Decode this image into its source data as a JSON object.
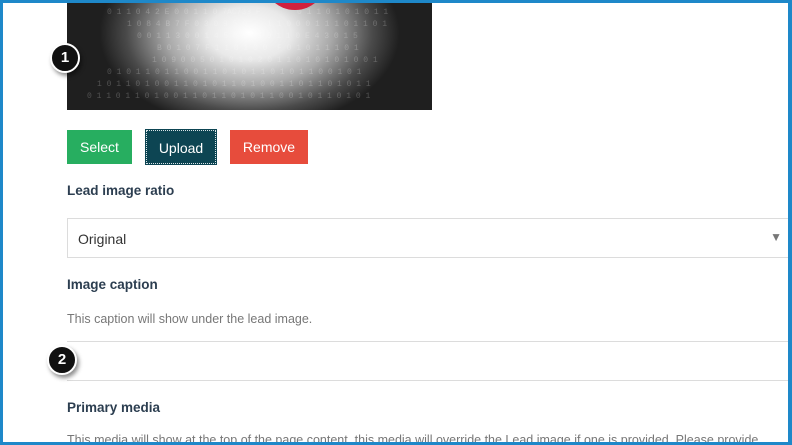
{
  "markers": {
    "first": "1",
    "second": "2"
  },
  "image_buttons": {
    "select": "Select",
    "upload": "Upload",
    "remove": "Remove"
  },
  "lead_image_ratio": {
    "label": "Lead image ratio",
    "selected": "Original",
    "caret": "▼"
  },
  "image_caption": {
    "label": "Image caption",
    "help": "This caption will show under the lead image.",
    "value": ""
  },
  "primary_media": {
    "label": "Primary media",
    "help": "This media will show at the top of the page content, this media will override the Lead image if one is provided. Please provide"
  },
  "colors": {
    "select": "#27ae60",
    "upload": "#0d4553",
    "remove": "#e74c3c",
    "frame": "#1e88c9"
  }
}
